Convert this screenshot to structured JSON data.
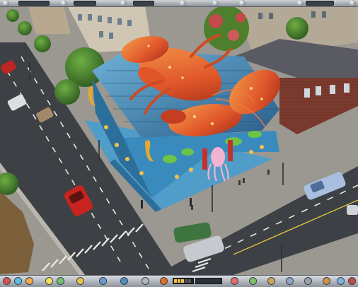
{
  "hud": {
    "top": {
      "fields": [
        {
          "id": "budget",
          "value": ""
        },
        {
          "id": "population",
          "value": ""
        },
        {
          "id": "rating",
          "value": ""
        },
        {
          "id": "date",
          "value": ""
        }
      ]
    },
    "bottom": {
      "buttons": [
        {
          "name": "build-menu-button",
          "icon": "hammer-icon",
          "color": "#d9534f"
        },
        {
          "name": "zones-button",
          "icon": "zone-icon",
          "color": "#5bc0de"
        },
        {
          "name": "roads-button",
          "icon": "road-icon",
          "color": "#f0ad4e"
        },
        {
          "name": "utilities-button",
          "icon": "bolt-icon",
          "color": "#f7e15a"
        },
        {
          "name": "services-button",
          "icon": "shield-icon",
          "color": "#6fc46f"
        },
        {
          "name": "finance-button",
          "icon": "coin-icon",
          "color": "#e9c54a"
        },
        {
          "name": "info-button",
          "icon": "info-icon",
          "color": "#6c9bd2"
        },
        {
          "name": "map-button",
          "icon": "globe-icon",
          "color": "#4a90c2"
        },
        {
          "name": "camera-button",
          "icon": "camera-icon",
          "color": "#b0b6bd"
        },
        {
          "name": "demolish-button",
          "icon": "bulldozer-icon",
          "color": "#e36d2b"
        },
        {
          "name": "options-button",
          "icon": "gear-icon",
          "color": "#9aa2ab"
        },
        {
          "name": "help-button",
          "icon": "help-icon",
          "color": "#7fb3e6"
        }
      ],
      "speed_level": 0.6,
      "time_text": ""
    }
  },
  "scene": {
    "building": "seafood-restaurant-lobster-landmark",
    "colors": {
      "asphalt": "#3d4045",
      "sidewalk": "#9c9c96",
      "lobster": "#e9652b",
      "roof": "#3e82b4",
      "grass": "#4e8f3a"
    }
  }
}
